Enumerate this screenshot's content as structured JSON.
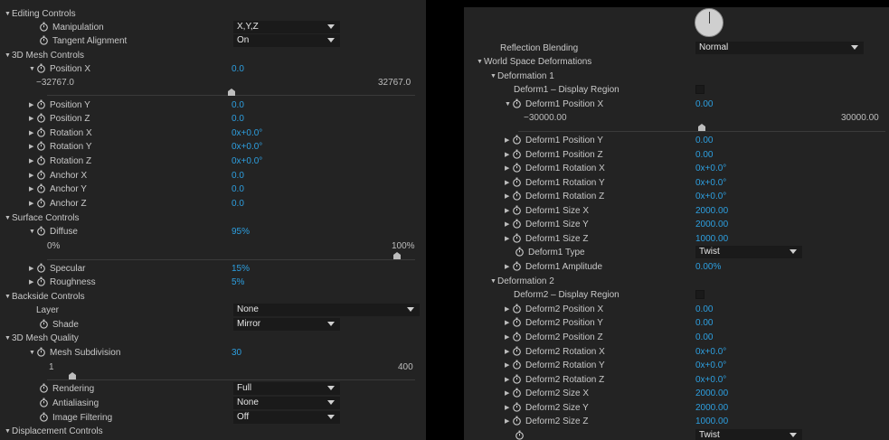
{
  "left": {
    "editing_controls": "Editing Controls",
    "manipulation_label": "Manipulation",
    "manipulation_value": "X,Y,Z",
    "tangent_label": "Tangent Alignment",
    "tangent_value": "On",
    "mesh_controls": "3D Mesh Controls",
    "posx_label": "Position X",
    "posx_value": "0.0",
    "posx_min": "−32767.0",
    "posx_max": "32767.0",
    "posx_slider_fraction": 0.5,
    "posy_label": "Position Y",
    "posy_value": "0.0",
    "posz_label": "Position Z",
    "posz_value": "0.0",
    "rotx_label": "Rotation X",
    "rotx_value": "0x+0.0°",
    "roty_label": "Rotation Y",
    "roty_value": "0x+0.0°",
    "rotz_label": "Rotation Z",
    "rotz_value": "0x+0.0°",
    "ancx_label": "Anchor X",
    "ancx_value": "0.0",
    "ancy_label": "Anchor Y",
    "ancy_value": "0.0",
    "ancz_label": "Anchor Z",
    "ancz_value": "0.0",
    "surface_controls": "Surface Controls",
    "diffuse_label": "Diffuse",
    "diffuse_value": "95%",
    "diffuse_min": "0%",
    "diffuse_max": "100%",
    "diffuse_slider_fraction": 0.95,
    "specular_label": "Specular",
    "specular_value": "15%",
    "roughness_label": "Roughness",
    "roughness_value": "5%",
    "backside_controls": "Backside Controls",
    "layer_label": "Layer",
    "layer_value": "None",
    "shade_label": "Shade",
    "shade_value": "Mirror",
    "mesh_quality": "3D Mesh Quality",
    "subdiv_label": "Mesh Subdivision",
    "subdiv_value": "30",
    "subdiv_min": "1",
    "subdiv_max": "400",
    "subdiv_slider_fraction": 0.07,
    "rendering_label": "Rendering",
    "rendering_value": "Full",
    "antialiasing_label": "Antialiasing",
    "antialiasing_value": "None",
    "filtering_label": "Image Filtering",
    "filtering_value": "Off",
    "displacement_controls": "Displacement Controls"
  },
  "right": {
    "reflection_label": "Reflection Blending",
    "reflection_value": "Normal",
    "world_space": "World Space Deformations",
    "deformation1": "Deformation 1",
    "d1_region_label": "Deform1 – Display Region",
    "d1_posx_label": "Deform1 Position X",
    "d1_posx_value": "0.00",
    "d1_posx_min": "−30000.00",
    "d1_posx_max": "30000.00",
    "d1_posx_slider_fraction": 0.5,
    "d1_posy_label": "Deform1 Position Y",
    "d1_posy_value": "0.00",
    "d1_posz_label": "Deform1 Position Z",
    "d1_posz_value": "0.00",
    "d1_rotx_label": "Deform1 Rotation X",
    "d1_rotx_value": "0x+0.0°",
    "d1_roty_label": "Deform1 Rotation Y",
    "d1_roty_value": "0x+0.0°",
    "d1_rotz_label": "Deform1 Rotation Z",
    "d1_rotz_value": "0x+0.0°",
    "d1_sizex_label": "Deform1 Size X",
    "d1_sizex_value": "2000.00",
    "d1_sizey_label": "Deform1 Size Y",
    "d1_sizey_value": "2000.00",
    "d1_sizez_label": "Deform1 Size Z",
    "d1_sizez_value": "1000.00",
    "d1_type_label": "Deform1 Type",
    "d1_type_value": "Twist",
    "d1_amp_label": "Deform1 Amplitude",
    "d1_amp_value": "0.00%",
    "deformation2": "Deformation 2",
    "d2_region_label": "Deform2 – Display Region",
    "d2_posx_label": "Deform2 Position X",
    "d2_posx_value": "0.00",
    "d2_posy_label": "Deform2 Position Y",
    "d2_posy_value": "0.00",
    "d2_posz_label": "Deform2 Position Z",
    "d2_posz_value": "0.00",
    "d2_rotx_label": "Deform2 Rotation X",
    "d2_rotx_value": "0x+0.0°",
    "d2_roty_label": "Deform2 Rotation Y",
    "d2_roty_value": "0x+0.0°",
    "d2_rotz_label": "Deform2 Rotation Z",
    "d2_rotz_value": "0x+0.0°",
    "d2_sizex_label": "Deform2 Size X",
    "d2_sizex_value": "2000.00",
    "d2_sizey_label": "Deform2 Size Y",
    "d2_sizey_value": "2000.00",
    "d2_sizez_label": "Deform2 Size Z",
    "d2_sizez_value": "1000.00",
    "d2_type_value": "Twist"
  },
  "colors": {
    "value_blue": "#2d9fe0",
    "panel_bg": "#232323",
    "dropdown_bg": "#1a1a1a"
  },
  "icons": {
    "stopwatch": "stopwatch-icon",
    "expand": "triangle-right-icon",
    "collapse": "triangle-down-icon",
    "dropdown": "chevron-down-icon"
  }
}
